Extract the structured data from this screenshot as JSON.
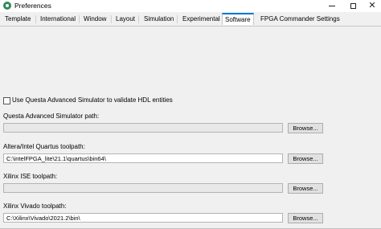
{
  "window": {
    "title": "Preferences",
    "minimize_glyph": "minimize",
    "maximize_glyph": "maximize",
    "close_glyph": "✕"
  },
  "tabs": [
    {
      "label": "Template"
    },
    {
      "label": "International"
    },
    {
      "label": "Window"
    },
    {
      "label": "Layout"
    },
    {
      "label": "Simulation"
    },
    {
      "label": "Experimental"
    },
    {
      "label": "Software",
      "active": true
    },
    {
      "label": "FPGA Commander Settings"
    }
  ],
  "software": {
    "questa_checkbox_label": "Use Questa Advanced Simulator to validate HDL entities",
    "questa_checkbox_checked": false,
    "questa_path_label": "Questa Advanced Simulator path:",
    "questa_path_value": "",
    "quartus_label": "Altera/Intel Quartus toolpath:",
    "quartus_value": "C:\\intelFPGA_lite\\21.1\\quartus\\bin64\\",
    "ise_label": "Xilinx ISE toolpath:",
    "ise_value": "",
    "vivado_label": "Xilinx Vivado toolpath:",
    "vivado_value": "C:\\Xilinx\\Vivado\\2021.2\\bin\\",
    "browse_label": "Browse..."
  }
}
